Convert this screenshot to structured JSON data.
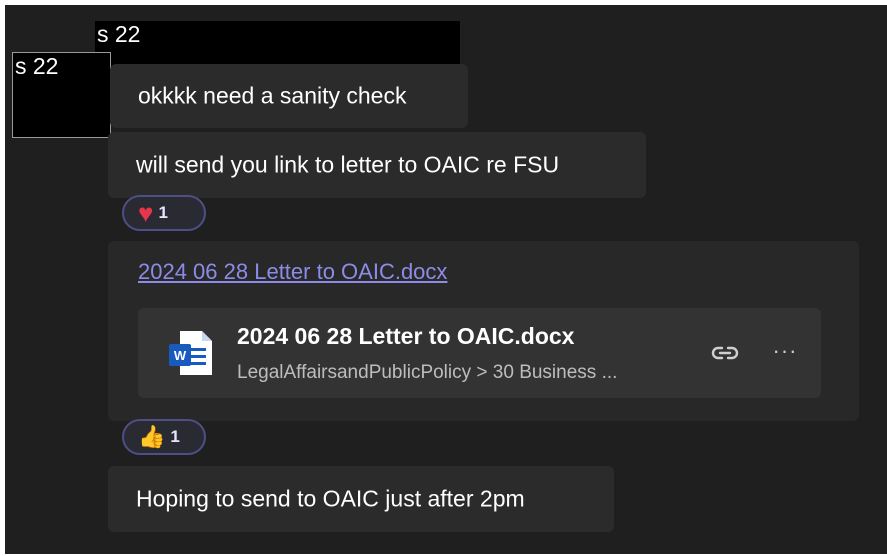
{
  "redactions": [
    {
      "label": "s 22"
    },
    {
      "label": "s 22"
    }
  ],
  "messages": [
    {
      "text": "okkkk need a sanity check"
    },
    {
      "text": "will send you link to letter to OAIC re FSU"
    },
    {
      "text": "Hoping to send to OAIC just after 2pm"
    }
  ],
  "reactions": [
    {
      "emoji": "heart-icon",
      "count": "1"
    },
    {
      "emoji": "thumbs-up-icon",
      "count": "1"
    }
  ],
  "attachment": {
    "link_text": "2024 06 28 Letter to OAIC.docx",
    "file_name": "2024 06 28 Letter to OAIC.docx",
    "file_path": "LegalAffairsandPublicPolicy > 30 Business ...",
    "icon": "word-doc-icon",
    "actions": {
      "copy_link": "link-icon",
      "more": "more-options-icon"
    }
  },
  "colors": {
    "background": "#1f1f1f",
    "bubble": "#2b2b2b",
    "link": "#8c8ce8",
    "reaction_border": "#4e4e88",
    "word_blue": "#185abd"
  }
}
